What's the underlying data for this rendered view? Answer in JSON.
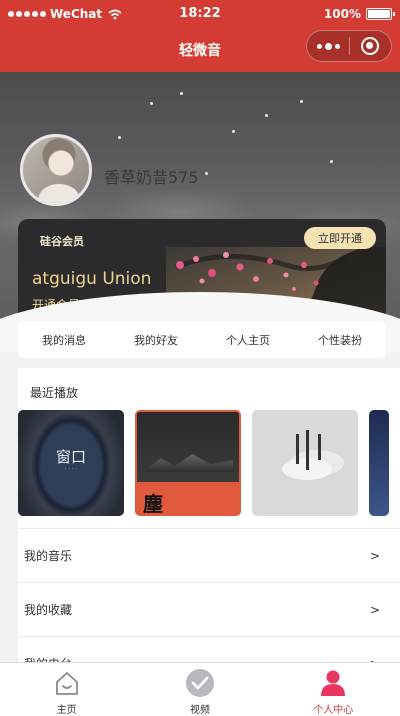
{
  "status_bar": {
    "carrier": "WeChat",
    "time": "18:22",
    "battery": "100%"
  },
  "nav": {
    "title": "轻微音"
  },
  "profile": {
    "username": "香草奶昔575"
  },
  "vip_card": {
    "label": "硅谷会员",
    "open_button": "立即开通",
    "title": "atguigu Union",
    "subtitle": "开通会员听歌，撸代码"
  },
  "quick_nav": {
    "items": [
      {
        "label": "我的消息"
      },
      {
        "label": "我的好友"
      },
      {
        "label": "个人主页"
      },
      {
        "label": "个性装扮"
      }
    ]
  },
  "recent": {
    "title": "最近播放",
    "cover_1_text": "窗口",
    "cover_2_text": "塵"
  },
  "list": {
    "items": [
      {
        "label": "我的音乐",
        "arrow": ">"
      },
      {
        "label": "我的收藏",
        "arrow": ">"
      },
      {
        "label": "我的电台",
        "arrow": ">"
      }
    ]
  },
  "tabbar": {
    "items": [
      {
        "label": "主页",
        "icon": "home-icon"
      },
      {
        "label": "视频",
        "icon": "check-circle-icon"
      },
      {
        "label": "个人中心",
        "icon": "person-icon"
      }
    ],
    "active_color": "#d43c33"
  },
  "colors": {
    "brand_red": "#d43c33",
    "vip_gold": "#f1d48a"
  }
}
